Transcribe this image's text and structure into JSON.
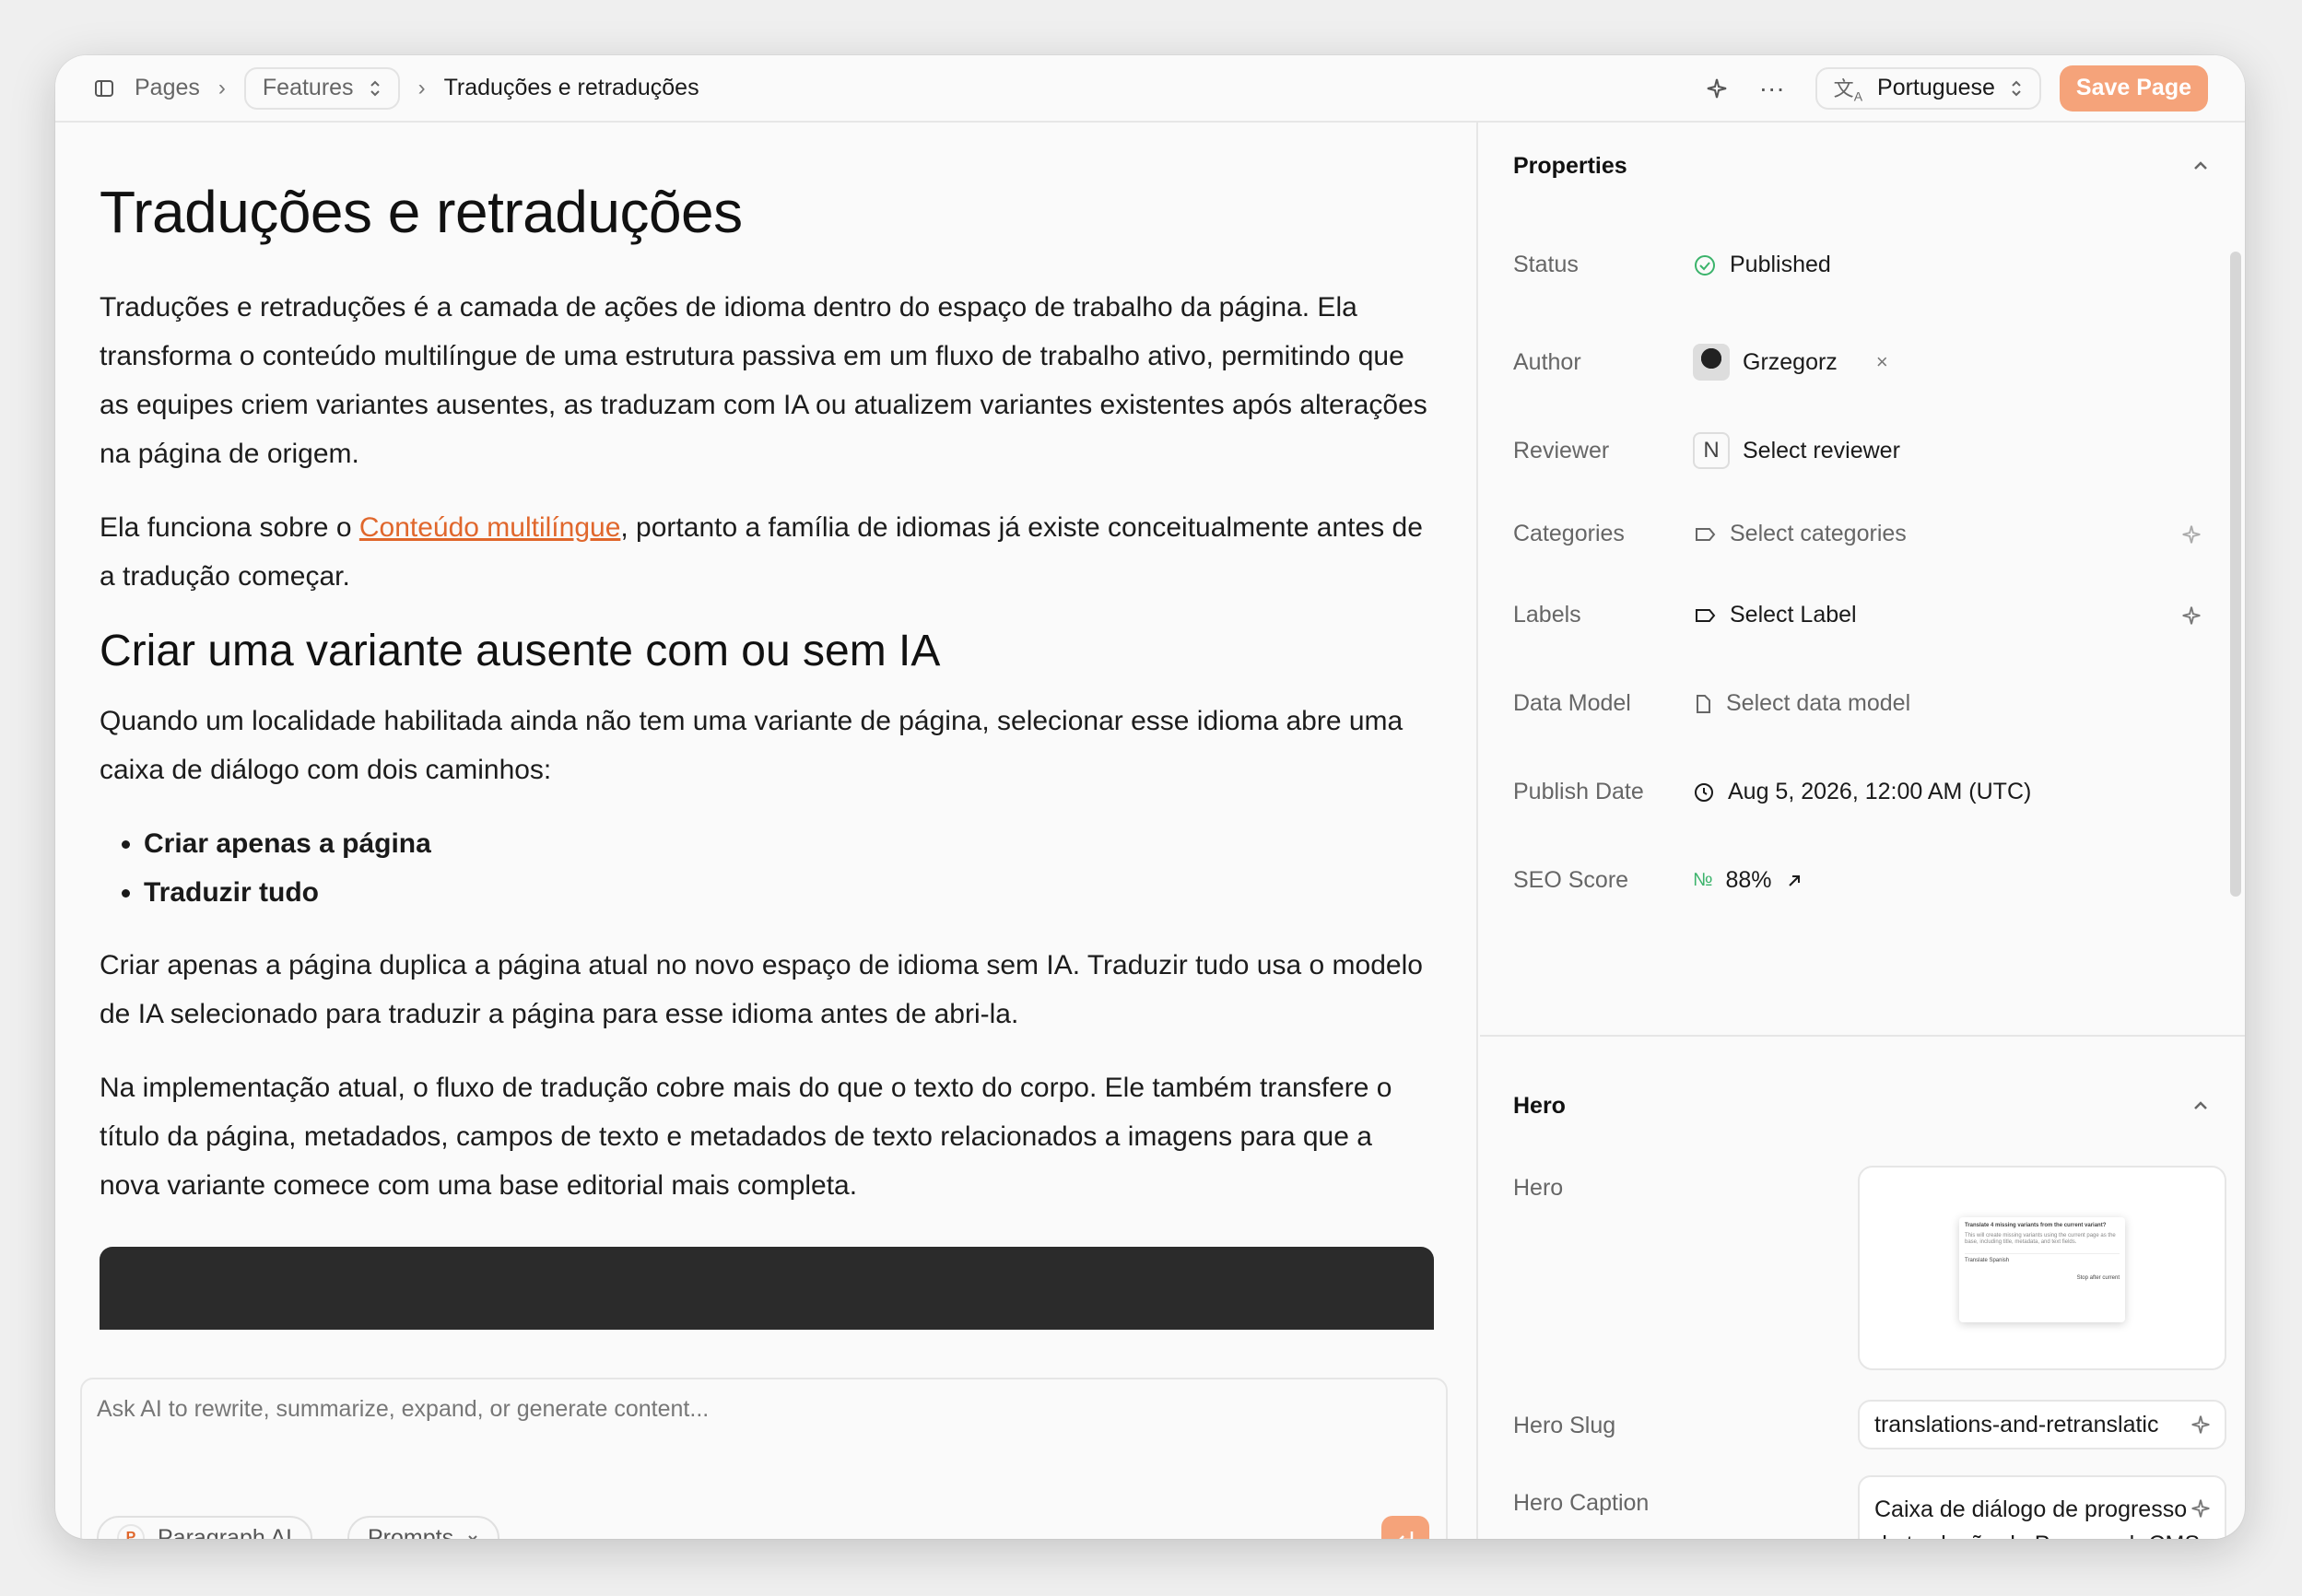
{
  "topbar": {
    "crumb_pages": "Pages",
    "crumb_features": "Features",
    "crumb_current": "Traduções e retraduções",
    "language": "Portuguese",
    "save_label": "Save Page"
  },
  "article": {
    "title": "Traduções e retraduções",
    "p1": "Traduções e retraduções é a camada de ações de idioma dentro do espaço de trabalho da página. Ela transforma o conteúdo multilíngue de uma estrutura passiva em um fluxo de trabalho ativo, permitindo que as equipes criem variantes ausentes, as traduzam com IA ou atualizem variantes existentes após alterações na página de origem.",
    "p2_before": "Ela funciona sobre o ",
    "p2_link": "Conteúdo multilíngue",
    "p2_after": ", portanto a família de idiomas já existe conceitualmente antes de a tradução começar.",
    "h2": "Criar uma variante ausente com ou sem IA",
    "p3": "Quando um localidade habilitada ainda não tem uma variante de página, selecionar esse idioma abre uma caixa de diálogo com dois caminhos:",
    "bullets": [
      "Criar apenas a página",
      "Traduzir tudo"
    ],
    "p4": "Criar apenas a página duplica a página atual no novo espaço de idioma sem IA. Traduzir tudo usa o modelo de IA selecionado para traduzir a página para esse idioma antes de abri-la.",
    "p5": "Na implementação atual, o fluxo de tradução cobre mais do que o texto do corpo. Ele também transfere o título da página, metadados, campos de texto e metadados de texto relacionados a imagens para que a nova variante comece com uma base editorial mais completa."
  },
  "ai": {
    "placeholder": "Ask AI to rewrite, summarize, expand, or generate content...",
    "chip_paragraph": "Paragraph AI",
    "chip_prompts": "Prompts"
  },
  "properties": {
    "title": "Properties",
    "status_label": "Status",
    "status_value": "Published",
    "author_label": "Author",
    "author_value": "Grzegorz",
    "reviewer_label": "Reviewer",
    "reviewer_initial": "N",
    "reviewer_value": "Select reviewer",
    "categories_label": "Categories",
    "categories_value": "Select categories",
    "labels_label": "Labels",
    "labels_value": "Select Label",
    "datamodel_label": "Data Model",
    "datamodel_value": "Select data model",
    "publish_label": "Publish Date",
    "publish_value": "Aug 5, 2026, 12:00 AM (UTC)",
    "seo_label": "SEO Score",
    "seo_value": "88%"
  },
  "hero": {
    "title": "Hero",
    "hero_label": "Hero",
    "thumb_heading": "Translate 4 missing variants from the current variant?",
    "thumb_body": "This will create missing variants using the current page as the base, including title, metadata, and text fields.",
    "thumb_row": "Translate Spanish",
    "thumb_button": "Stop after current",
    "slug_label": "Hero Slug",
    "slug_value": "translations-and-retranslatic",
    "caption_label": "Hero Caption",
    "caption_value": "Caixa de diálogo de progresso de tradução do Paragraph CMS exibindo o status de uma"
  },
  "colors": {
    "accent": "#e0672c",
    "button": "#f5a37a",
    "status_green": "#3bb36b"
  }
}
